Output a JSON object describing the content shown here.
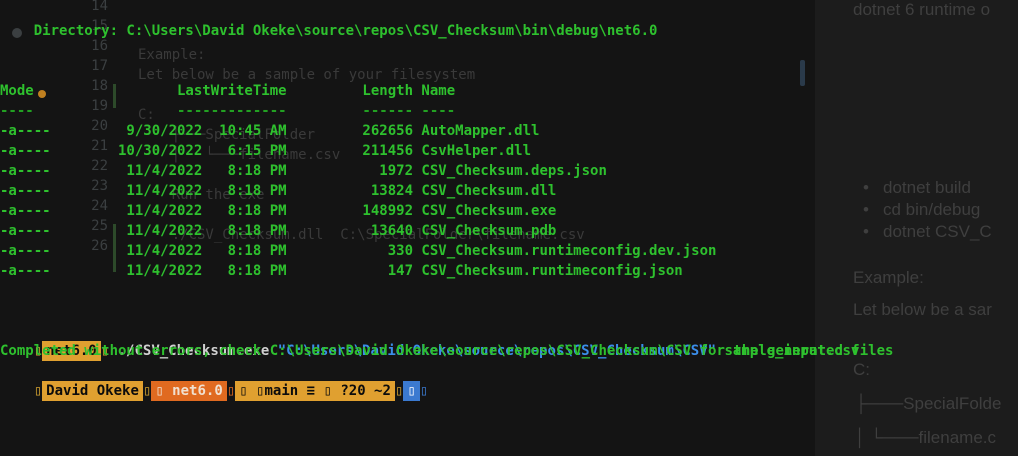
{
  "editor": {
    "line_numbers": [
      "14",
      "15",
      "16",
      "17",
      "18",
      "19",
      "20",
      "21",
      "22",
      "23",
      "24",
      "25",
      "26"
    ],
    "code_lines": [
      "",
      "",
      "Example:",
      "Let below be a sample of your filesystem",
      "",
      "C:",
      "    ├───SpecialFolder",
      "    │   └───filename.csv",
      "",
      "    Run the exe",
      "",
      "    ./CSV_Checksum.dll  C:\\SpecialFolder\\filename.csv",
      ""
    ]
  },
  "preview": {
    "top_text": "dotnet 6 runtime o",
    "bullets": [
      "dotnet build",
      "cd bin/debug",
      "dotnet CSV_C"
    ],
    "example": "Example:",
    "let_below": "Let below be a sar",
    "c_drive": "C:",
    "special_folder": "├───SpecialFolde",
    "filename": "│   └───filename.c"
  },
  "terminal": {
    "directory": "    Directory: C:\\Users\\David Okeke\\source\\repos\\CSV_Checksum\\bin\\debug\\net6.0",
    "header": "Mode                 LastWriteTime         Length Name",
    "underline": "----                 -------------         ------ ----",
    "rows": [
      "-a----         9/30/2022  10:45 AM         262656 AutoMapper.dll",
      "-a----        10/30/2022   6:15 PM         211456 CsvHelper.dll",
      "-a----         11/4/2022   8:18 PM           1972 CSV_Checksum.deps.json",
      "-a----         11/4/2022   8:18 PM          13824 CSV_Checksum.dll",
      "-a----         11/4/2022   8:18 PM         148992 CSV_Checksum.exe",
      "-a----         11/4/2022   8:18 PM          13640 CSV_Checksum.pdb",
      "-a----         11/4/2022   8:18 PM            330 CSV_Checksum.runtimeconfig.dev.json",
      "-a----         11/4/2022   8:18 PM            147 CSV_Checksum.runtimeconfig.json"
    ],
    "prompt1": {
      "lead": "▯",
      "dir_segment": "net6.0",
      "sep": "▯",
      "command": " ./CSV_Checksum.exe ",
      "arg_path": "\"C:\\Users\\David Okeke\\source\\repos\\CSV_Checksum\\CSV\"",
      "arg_file": " sample_input.csv"
    },
    "output": "Completed without errors, check C:\\Users\\David Okeke\\source\\repos\\CSV_Checksum\\CSV for the generated files",
    "prompt2": {
      "lead": "▯",
      "user_segment": "David Okeke",
      "sep1": "▯",
      "dir_segment": "▯ net6.0",
      "sep2": "▯",
      "git_segment": "▯ ▯main ≡ ▯ ?20 ~2",
      "sep3": "▯",
      "end_segment": "▯",
      "tail": "▯"
    }
  },
  "colors": {
    "terminal_green": "#2ec12e",
    "path_blue": "#3b8eea",
    "segment_yellow": "#e0a030",
    "segment_orange": "#e06a20",
    "segment_blue": "#3b7ad0"
  }
}
